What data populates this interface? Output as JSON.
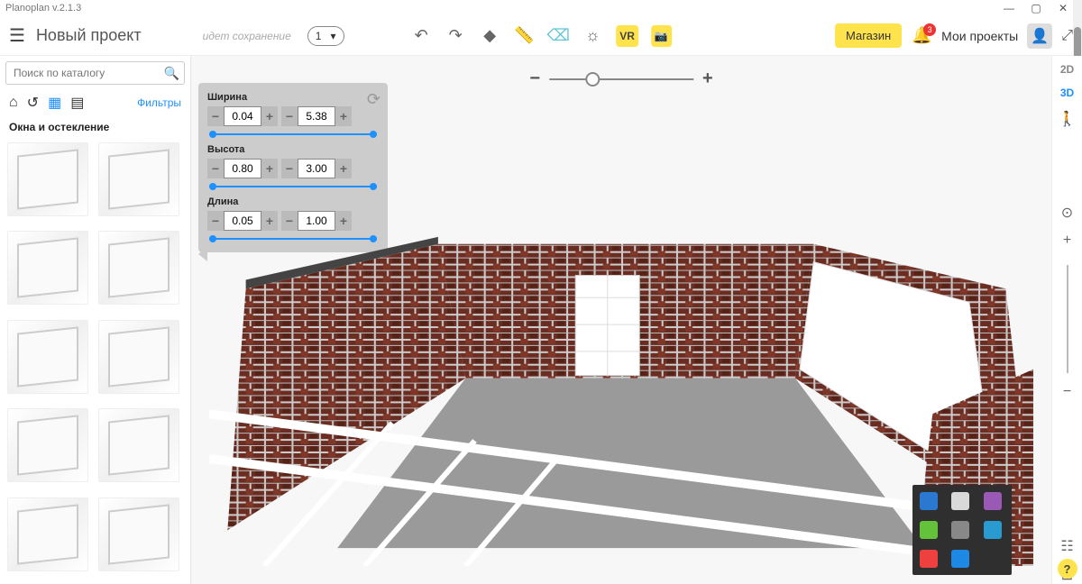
{
  "app_title": "Planoplan v.2.1.3",
  "window": {
    "min": "—",
    "max": "▢",
    "close": "✕"
  },
  "toolbar": {
    "project_title": "Новый проект",
    "saving_status": "идет сохранение",
    "history_count": "1",
    "vr_label": "VR",
    "store_label": "Магазин",
    "notifications_count": "3",
    "my_projects_label": "Мои проекты"
  },
  "sidebar": {
    "search_placeholder": "Поиск по каталогу",
    "filters_label": "Фильтры",
    "category_title": "Окна и остекление"
  },
  "properties": {
    "width_label": "Ширина",
    "width_min": "0.04",
    "width_max": "5.38",
    "height_label": "Высота",
    "height_min": "0.80",
    "height_max": "3.00",
    "length_label": "Длина",
    "length_min": "0.05",
    "length_max": "1.00"
  },
  "zoom": {
    "minus": "−",
    "plus": "+"
  },
  "rail": {
    "mode_2d": "2D",
    "mode_3d": "3D",
    "help": "?"
  },
  "tray_colors": [
    "#2a78d0",
    "#d9d9d9",
    "#9b59b6",
    "#64c23a",
    "#888",
    "#2a9bd0",
    "#ef4040",
    "#1e88e5"
  ]
}
